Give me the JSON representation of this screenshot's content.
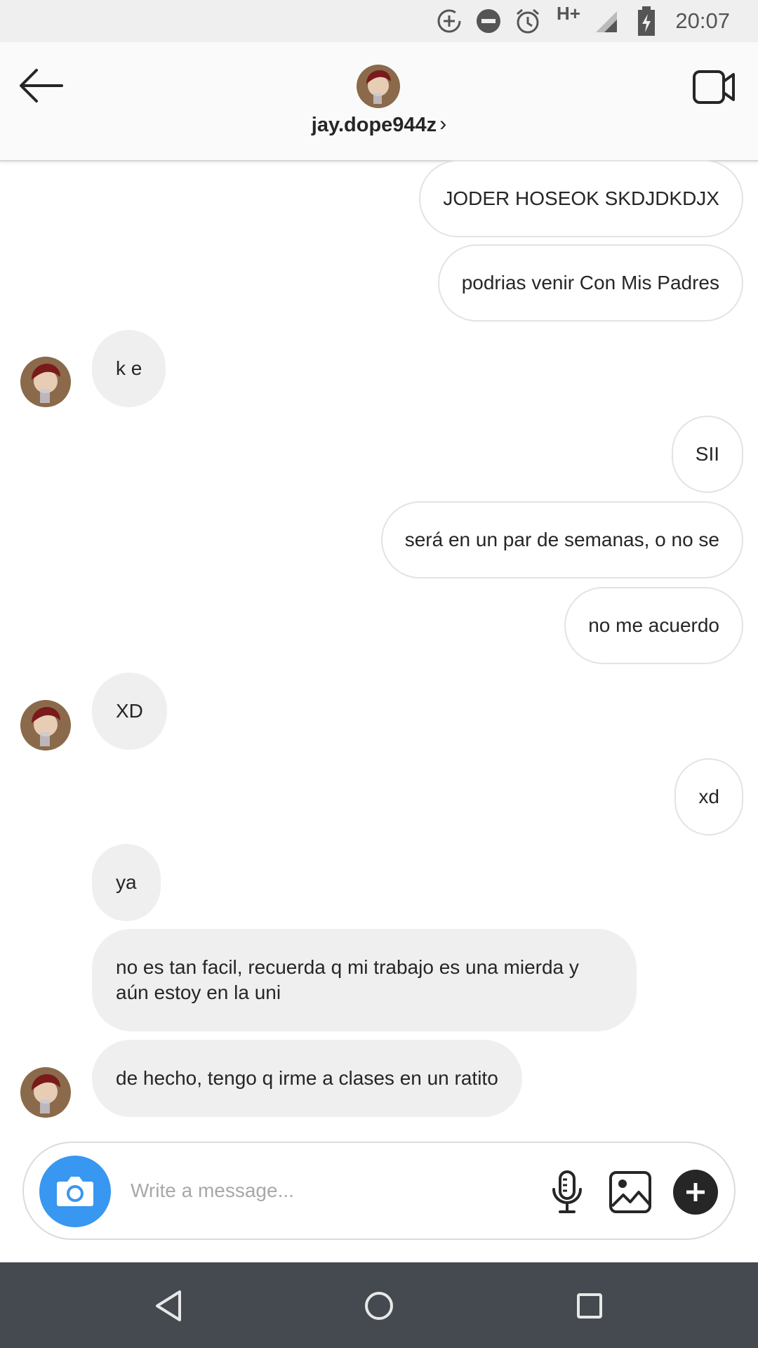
{
  "status_bar": {
    "time": "20:07",
    "network": "H+",
    "icons": [
      "data-saver-icon",
      "do-not-disturb-icon",
      "alarm-icon",
      "signal-icon",
      "battery-charging-icon"
    ]
  },
  "header": {
    "username": "jay.dope944z",
    "back_icon": "arrow-left-icon",
    "video_icon": "video-camera-icon"
  },
  "messages": [
    {
      "direction": "outgoing",
      "text": "JODER HOSEOK SKDJDKDJX"
    },
    {
      "direction": "outgoing",
      "text": "podrias venir Con Mis Padres"
    },
    {
      "direction": "incoming",
      "text": "k e",
      "avatar": true
    },
    {
      "direction": "outgoing",
      "text": "SII"
    },
    {
      "direction": "outgoing",
      "text": "será en un par de semanas, o no se"
    },
    {
      "direction": "outgoing",
      "text": "no me acuerdo"
    },
    {
      "direction": "incoming",
      "text": "XD",
      "avatar": true
    },
    {
      "direction": "outgoing",
      "text": "xd"
    },
    {
      "direction": "incoming",
      "text": "ya",
      "avatar": false
    },
    {
      "direction": "incoming",
      "text": "no es tan facil, recuerda q mi trabajo es una mierda y aún estoy en la uni",
      "avatar": false
    },
    {
      "direction": "incoming",
      "text": "de hecho, tengo q irme a clases en un ratito",
      "avatar": true
    }
  ],
  "composer": {
    "placeholder": "Write a message...",
    "value": "",
    "icons": [
      "camera-icon",
      "microphone-icon",
      "gallery-icon",
      "plus-icon"
    ]
  },
  "nav_bar": {
    "icons": [
      "back-triangle-icon",
      "home-circle-icon",
      "recents-square-icon"
    ]
  },
  "colors": {
    "accent": "#3897f0",
    "incoming_bubble": "#efefef",
    "outgoing_border": "#e3e3e3",
    "nav_bar": "#454a50",
    "status_bar": "#efefef"
  }
}
